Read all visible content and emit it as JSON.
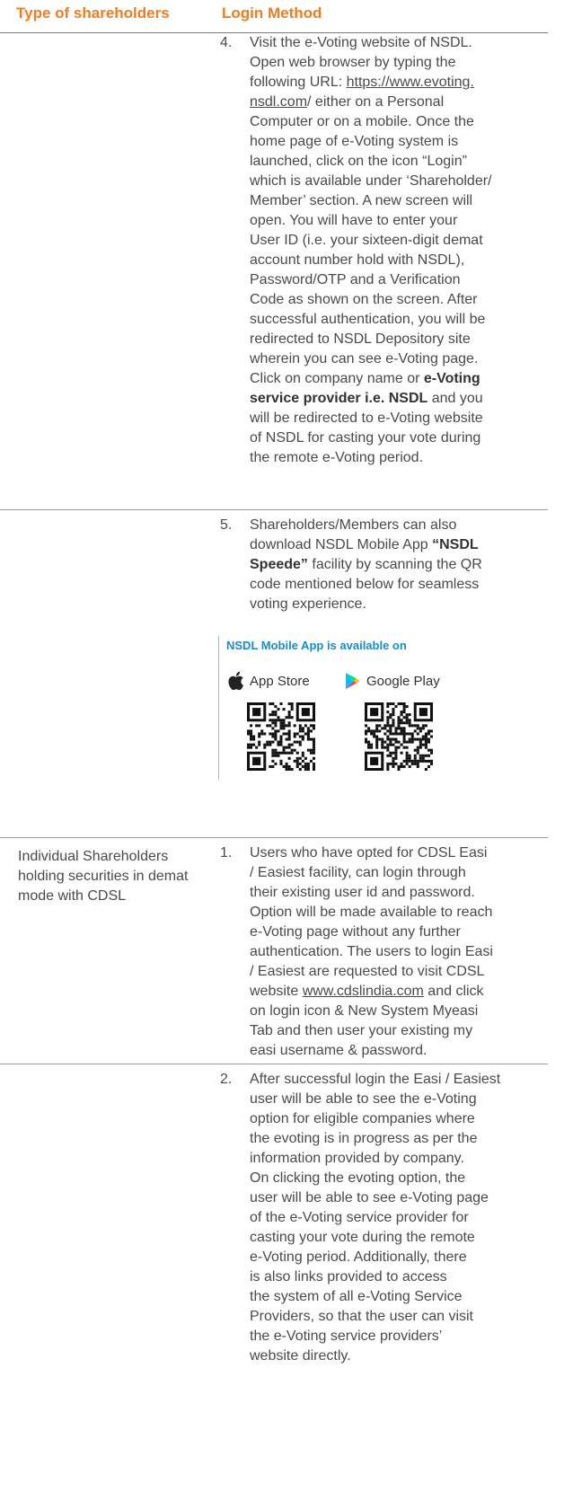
{
  "header": {
    "col1": "Type of shareholders",
    "col2": "Login Method"
  },
  "nsdl_rows": [
    {
      "number": "4.",
      "lines": [
        "Visit the e-Voting website of NSDL.",
        "Open web browser by typing the",
        "following URL: <a>https://www.evoting.</a>",
        "<a>nsdl.com</a>/ either on a Personal",
        "Computer or on a mobile. Once the",
        "home page of e-Voting system is",
        "launched, click on the icon “Login”",
        "which is available under ‘Shareholder/",
        "Member’ section. A new screen will",
        "open. You will have to enter your",
        "User ID (i.e. your sixteen-digit demat",
        "account number hold with NSDL),",
        "Password/OTP and a Verification",
        "Code as shown on the screen. After",
        "successful authentication, you will be",
        "redirected to NSDL Depository site",
        "wherein you can see e-Voting page.",
        "Click on company name or <b>e-Voting</b>",
        "<b>service provider i.e. NSDL</b> and you",
        "will be redirected to e-Voting website",
        "of NSDL for casting your vote during",
        "the remote e-Voting period."
      ]
    },
    {
      "number": "5.",
      "lines": [
        "Shareholders/Members can also",
        "download NSDL Mobile App <b>“NSDL</b>",
        "<b>Speede”</b> facility by scanning the QR",
        "code mentioned below for seamless",
        "voting experience."
      ]
    }
  ],
  "app_box": {
    "title": "NSDL Mobile App is available on",
    "app_store": "App Store",
    "google_play": "Google Play"
  },
  "cdsl_type": "Individual Shareholders holding securities in demat mode with CDSL",
  "cdsl_rows": [
    {
      "number": "1.",
      "lines": [
        "Users who have opted for CDSL Easi",
        "/ Easiest facility, can login through",
        "their existing user id and password.",
        "Option will be made available to reach",
        "e-Voting page without any further",
        "authentication. The users to login Easi",
        "/ Easiest are requested to visit CDSL",
        "website <a>www.cdslindia.com</a> and click",
        "on login icon & New System Myeasi",
        "Tab and then user your existing my",
        "easi username & password."
      ]
    },
    {
      "number": "2.",
      "lines": [
        "After successful login the Easi / Easiest",
        "user will be able to see the e-Voting",
        "option for eligible companies where",
        "the evoting is in progress as per the",
        "information provided by company.",
        "On clicking the evoting option, the",
        "user will be able to see e-Voting page",
        "of the e-Voting service provider for",
        "casting your vote during the remote",
        "e-Voting period. Additionally, there",
        "is also links provided to access",
        "the system of all e-Voting Service",
        "Providers, so that the user can visit",
        "the e-Voting service providers’",
        "website directly."
      ]
    }
  ],
  "colors": {
    "header_orange": "#ef7d22",
    "app_title_blue": "#1a8bc8",
    "text": "#4a4a4a"
  }
}
